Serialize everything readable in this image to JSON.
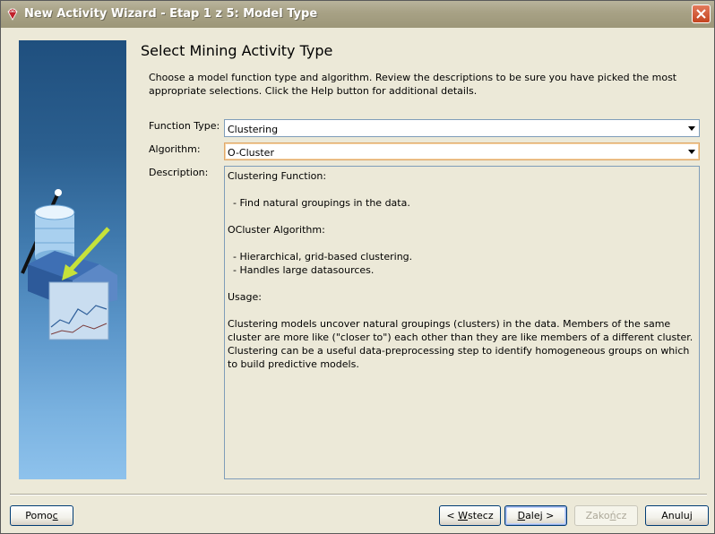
{
  "window": {
    "title": "New Activity Wizard - Etap 1 z 5: Model Type"
  },
  "page": {
    "heading": "Select Mining Activity Type",
    "intro": "Choose a model function type and algorithm.  Review the descriptions to be sure you have picked the most appropriate selections. Click the Help button for additional details."
  },
  "form": {
    "function_type": {
      "label": "Function Type:",
      "value": "Clustering"
    },
    "algorithm": {
      "label": "Algorithm:",
      "value": "O-Cluster"
    },
    "description": {
      "label": "Description:",
      "lines": {
        "l1": "Clustering Function:",
        "l2": "- Find natural groupings in the data.",
        "l3": "OCluster Algorithm:",
        "l4": "- Hierarchical, grid-based clustering.",
        "l5": "- Handles large datasources.",
        "l6": "Usage:",
        "l7": "Clustering models uncover natural groupings (clusters) in the data. Members of the same cluster are more like (\"closer to\") each other than they are like members of a different cluster. Clustering can be a useful data-preprocessing step to identify homogeneous groups on which to build predictive models."
      }
    }
  },
  "buttons": {
    "help": {
      "pre": "Pomo",
      "mnemonic": "c",
      "post": ""
    },
    "back": {
      "pre": "< ",
      "mnemonic": "W",
      "post": "stecz"
    },
    "next": {
      "pre": "",
      "mnemonic": "D",
      "post": "alej >"
    },
    "finish": {
      "pre": "Zako",
      "mnemonic": "ń",
      "post": "cz"
    },
    "cancel": {
      "pre": "Anuluj",
      "mnemonic": "",
      "post": ""
    }
  },
  "colors": {
    "title_bar": "#a8a286",
    "close_button": "#c4441f",
    "sidebar_top": "#1f4f7e",
    "sidebar_bottom": "#8ec2ec"
  },
  "icons": {
    "app": "ruby-gem-icon",
    "close": "close-icon",
    "dropdown": "chevron-down-icon"
  }
}
